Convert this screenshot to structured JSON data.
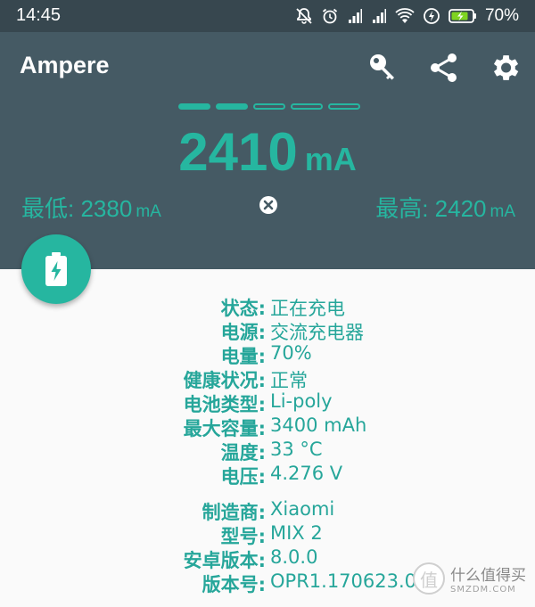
{
  "status_bar": {
    "time": "14:45",
    "battery_percent": "70%",
    "icons": [
      "mute-bell-icon",
      "alarm-icon",
      "signal-icon",
      "signal-icon",
      "wifi-icon",
      "charging-icon",
      "battery-icon"
    ]
  },
  "app": {
    "title": "Ampere",
    "toolbar": [
      "key-icon",
      "share-icon",
      "settings-icon"
    ],
    "pager": {
      "pages": 5,
      "active": 2
    }
  },
  "current": {
    "value": "2410",
    "unit": "mA"
  },
  "min": {
    "label": "最低:",
    "value": "2380",
    "unit": "mA"
  },
  "max": {
    "label": "最高:",
    "value": "2420",
    "unit": "mA"
  },
  "details": [
    {
      "label": "状态:",
      "value": "正在充电"
    },
    {
      "label": "电源:",
      "value": "交流充电器"
    },
    {
      "label": "电量:",
      "value": "70%"
    },
    {
      "label": "健康状况:",
      "value": "正常"
    },
    {
      "label": "电池类型:",
      "value": "Li-poly"
    },
    {
      "label": "最大容量:",
      "value": "3400 mAh"
    },
    {
      "label": "温度:",
      "value": "33 °C"
    },
    {
      "label": "电压:",
      "value": "4.276 V"
    },
    {
      "label": "制造商:",
      "value": "Xiaomi"
    },
    {
      "label": "型号:",
      "value": "MIX 2"
    },
    {
      "label": "安卓版本:",
      "value": "8.0.0"
    },
    {
      "label": "版本号:",
      "value": "OPR1.170623.02"
    }
  ],
  "watermark": {
    "logo": "值",
    "title": "什么值得买",
    "site": "SMZDM.COM"
  },
  "colors": {
    "accent": "#26b6a0",
    "header": "#455a64",
    "statusbar": "#37474f"
  }
}
